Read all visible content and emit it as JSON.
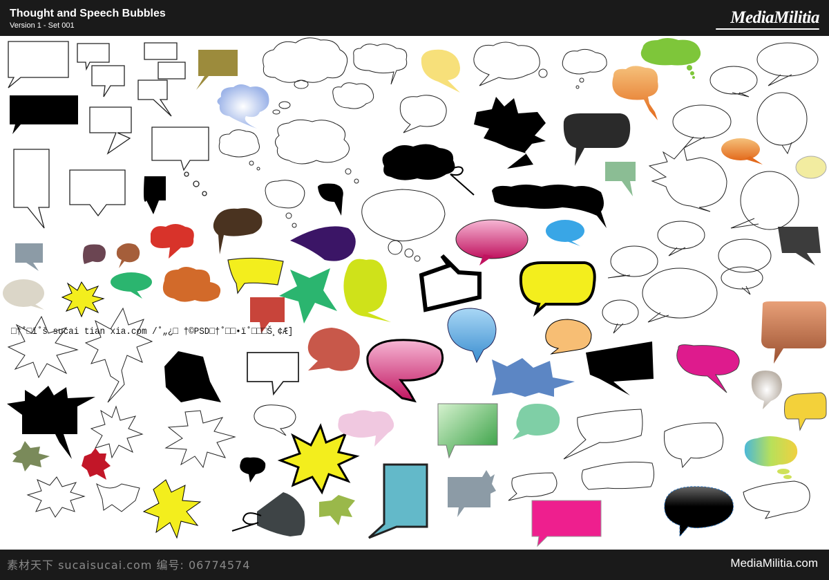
{
  "header": {
    "title": "Thought and Speech Bubbles",
    "subtitle": "Version 1 - Set 001",
    "logo": "MediaMilitia"
  },
  "footer": {
    "watermark": "素材天下 sucaisucai.com   编号: 06774574",
    "site": "MediaMilitia.com"
  },
  "overlay_text": "□†˚□ï˚š  sucai tian xia.com /˚„¿□  †©PSD□†˚□□•ï˚□□□Š¸¢Æ]",
  "colors": {
    "bar": "#1a1a1a",
    "olive": "#9c8b3c",
    "lime": "#7ec63a",
    "orange": "#e88040",
    "yellow_soft": "#f7e07a",
    "pink": "#e0157a",
    "purple": "#3b1566",
    "brown": "#4a3320",
    "red": "#d8332a",
    "sky": "#39a6e6",
    "yellow": "#f3ee1d",
    "green_teal": "#2bb56f",
    "teal": "#3bb8a0",
    "peach": "#f7be74",
    "blue_star": "#5c86c4",
    "green_gloss": "#4dbb4a",
    "mint": "#7fcfa6",
    "cyan": "#63b9c9",
    "slate": "#8c9ba6",
    "magenta": "#ee1f8e",
    "rust": "#c37651"
  }
}
